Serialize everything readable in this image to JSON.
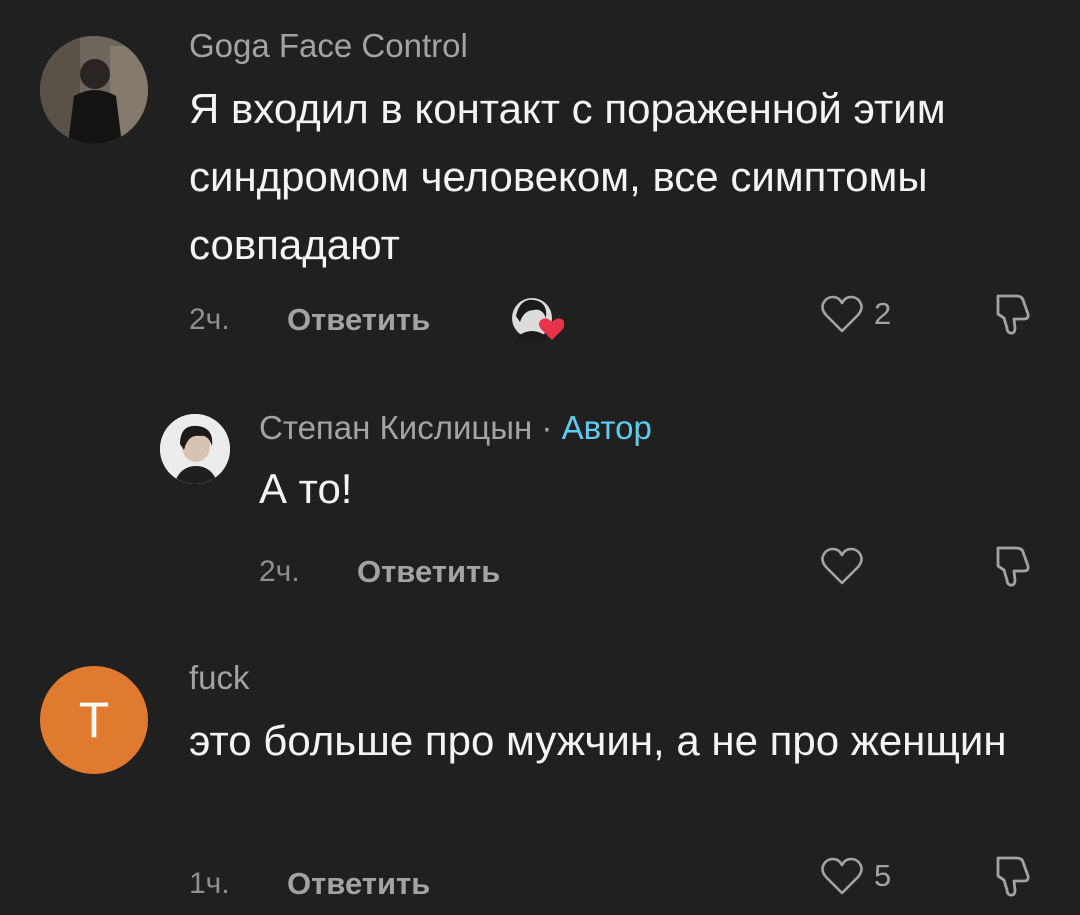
{
  "comments": [
    {
      "author": "Goga Face Control",
      "text": "Я входил в контакт с пораженной этим синдромом человеком, все симптомы совпадают",
      "time": "2ч.",
      "reply_label": "Ответить",
      "likes": "2"
    },
    {
      "author": "Степан Кислицын",
      "separator": "·",
      "author_badge": "Автор",
      "text": "А то!",
      "time": "2ч.",
      "reply_label": "Ответить",
      "likes": ""
    },
    {
      "author": "fuck",
      "avatar_letter": "T",
      "text": "это больше про мужчин, а не про женщин",
      "time": "1ч.",
      "reply_label": "Ответить",
      "likes": "5"
    }
  ],
  "icons": {
    "like": "heart-outline-icon",
    "dislike": "thumbs-down-outline-icon",
    "creator_liked": "creator-heart-badge-icon"
  },
  "colors": {
    "background": "#202020",
    "author_badge": "#5ecbef",
    "letter_avatar": "#e07a2e",
    "heart_red": "#e8324a"
  }
}
